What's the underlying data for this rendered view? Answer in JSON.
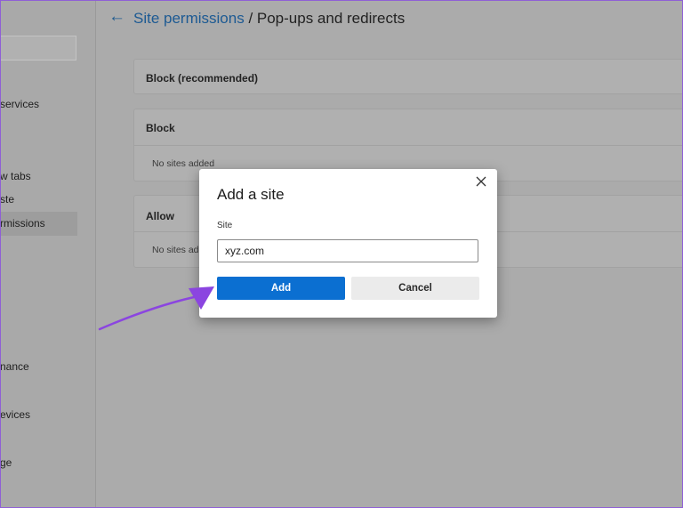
{
  "sidebar": {
    "items": [
      {
        "label": " services"
      },
      {
        "label": "w tabs"
      },
      {
        "label": "ste"
      },
      {
        "label": "rmissions"
      },
      {
        "label": "nance"
      },
      {
        "label": "evices"
      },
      {
        "label": "ge"
      }
    ]
  },
  "header": {
    "breadcrumb": "Site permissions",
    "separator": " / ",
    "title": "Pop-ups and redirects"
  },
  "sections": {
    "block_recommended": {
      "label": "Block (recommended)"
    },
    "block": {
      "label": "Block",
      "empty": "No sites added"
    },
    "allow": {
      "label": "Allow",
      "empty": "No sites adde"
    }
  },
  "dialog": {
    "title": "Add a site",
    "field_label": "Site",
    "field_value": "xyz.com",
    "add_label": "Add",
    "cancel_label": "Cancel"
  },
  "icons": {
    "back": "back-arrow-icon",
    "close": "close-icon",
    "annotation": "annotation-arrow-icon"
  },
  "colors": {
    "accent": "#0b6fd1",
    "link": "#1d5a93",
    "annotation": "#8b45e0"
  }
}
